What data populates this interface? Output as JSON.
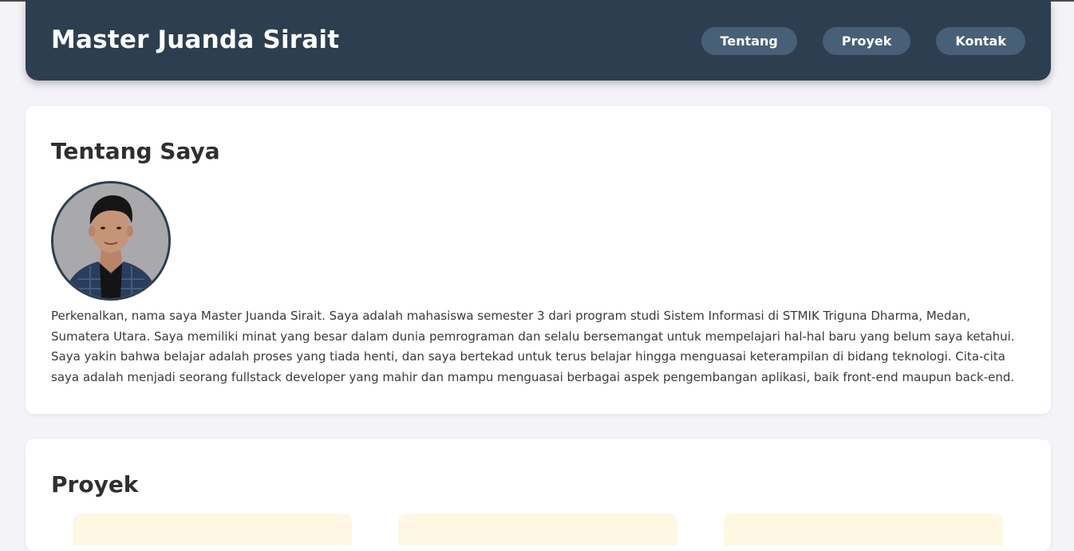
{
  "header": {
    "title": "Master Juanda Sirait",
    "nav": [
      "Tentang",
      "Proyek",
      "Kontak"
    ]
  },
  "about": {
    "title": "Tentang Saya",
    "text": "Perkenalkan, nama saya Master Juanda Sirait. Saya adalah mahasiswa semester 3 dari program studi Sistem Informasi di STMIK Triguna Dharma, Medan, Sumatera Utara. Saya memiliki minat yang besar dalam dunia pemrograman dan selalu bersemangat untuk mempelajari hal-hal baru yang belum saya ketahui. Saya yakin bahwa belajar adalah proses yang tiada henti, dan saya bertekad untuk terus belajar hingga menguasai keterampilan di bidang teknologi. Cita-cita saya adalah menjadi seorang fullstack developer yang mahir dan mampu menguasai berbagai aspek pengembangan aplikasi, baik front-end maupun back-end."
  },
  "projects": {
    "title": "Proyek"
  },
  "colors": {
    "header_bg": "#2d3e50",
    "nav_button_bg": "#476077",
    "page_bg": "#f4f3f8",
    "project_card_bg": "#fef8e2"
  }
}
